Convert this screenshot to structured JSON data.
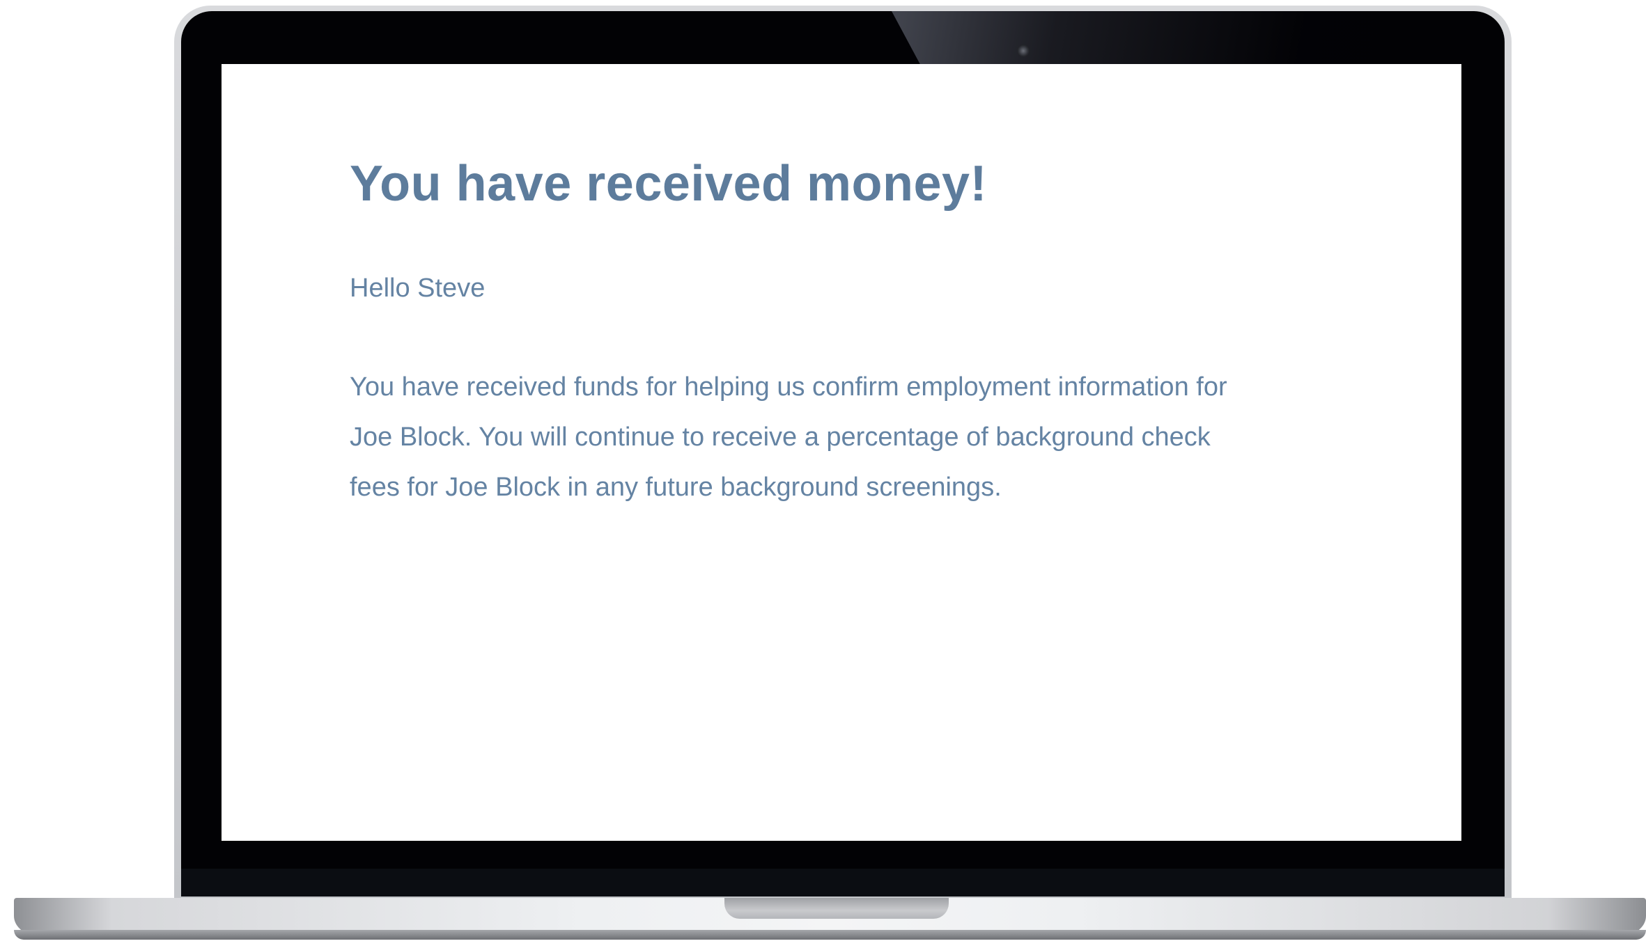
{
  "email": {
    "title": "You have received money!",
    "greeting": "Hello Steve",
    "body": "You have received funds for helping us confirm employment information for Joe Block. You will continue to receive a percentage of background check fees for Joe Block in any future background screenings."
  },
  "colors": {
    "text": "#6483a3",
    "heading": "#5d7c9c",
    "screen_background": "#ffffff",
    "bezel": "#020205"
  }
}
